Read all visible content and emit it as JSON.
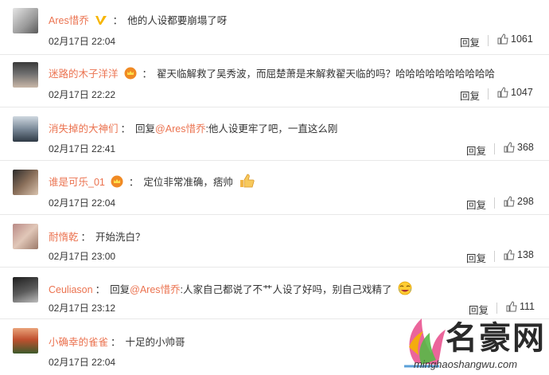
{
  "comments": [
    {
      "username": "Ares惜乔",
      "badge": "v-verified",
      "text": "他的人设都要崩塌了呀",
      "time": "02月17日 22:04",
      "reply": "回复",
      "likes": "1061"
    },
    {
      "username": "迷路的木子洋洋",
      "badge": "crown",
      "text": "翟天临解救了吴秀波，而屈楚萧是来解救翟天临的吗？哈哈哈哈哈哈哈哈哈哈",
      "time": "02月17日 22:22",
      "reply": "回复",
      "likes": "1047"
    },
    {
      "username": "消失掉的大神们",
      "reply_prefix": "回复",
      "at": "@Ares惜乔",
      "text": ":他人设更牢了吧，一直这么刚",
      "time": "02月17日 22:41",
      "reply": "回复",
      "likes": "368"
    },
    {
      "username": "谁是可乐_01",
      "badge": "crown",
      "text": "定位非常准确，痞帅",
      "emoji": "thumbs-up",
      "time": "02月17日 22:04",
      "reply": "回复",
      "likes": "298"
    },
    {
      "username": "耐惰乾",
      "text": "开始洗白？",
      "time": "02月17日 23:00",
      "reply": "回复",
      "likes": "138"
    },
    {
      "username": "Ceuliason",
      "reply_prefix": "回复",
      "at": "@Ares惜乔",
      "text": ":人家自己都说了不艹人设了好吗，别自己戏精了",
      "emoji": "laugh-cry",
      "time": "02月17日 23:12",
      "reply": "回复",
      "likes": "111"
    },
    {
      "username": "小确幸的雀雀",
      "text": "十足的小帅哥",
      "time": "02月17日 22:04"
    }
  ],
  "watermark": {
    "brand": "名豪网",
    "url": "minghaoshangwu.com"
  },
  "colors": {
    "username": "#eb7350",
    "text": "#333333",
    "divider": "#e8e8e8"
  }
}
